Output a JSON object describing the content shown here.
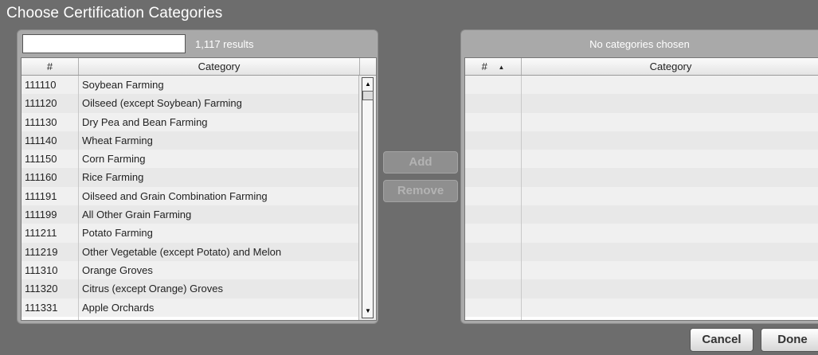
{
  "dialog": {
    "title": "Choose Certification Categories"
  },
  "left": {
    "search_value": "",
    "results": "1,117 results",
    "columns": {
      "num": "#",
      "category": "Category"
    },
    "rows": [
      {
        "num": "111110",
        "category": "Soybean Farming"
      },
      {
        "num": "111120",
        "category": "Oilseed (except Soybean) Farming"
      },
      {
        "num": "111130",
        "category": "Dry Pea and Bean Farming"
      },
      {
        "num": "111140",
        "category": "Wheat Farming"
      },
      {
        "num": "111150",
        "category": "Corn Farming"
      },
      {
        "num": "111160",
        "category": "Rice Farming"
      },
      {
        "num": "111191",
        "category": "Oilseed and Grain Combination Farming"
      },
      {
        "num": "111199",
        "category": "All Other Grain Farming"
      },
      {
        "num": "111211",
        "category": "Potato Farming"
      },
      {
        "num": "111219",
        "category": "Other Vegetable (except Potato) and Melon"
      },
      {
        "num": "111310",
        "category": "Orange Groves"
      },
      {
        "num": "111320",
        "category": "Citrus (except Orange) Groves"
      },
      {
        "num": "111331",
        "category": "Apple Orchards"
      }
    ],
    "scroll_up_glyph": "▲",
    "scroll_down_glyph": "▼"
  },
  "middle": {
    "add_label": "Add",
    "remove_label": "Remove"
  },
  "right": {
    "status": "No categories chosen",
    "columns": {
      "num": "#",
      "sort_glyph": "▲",
      "category": "Category"
    }
  },
  "footer": {
    "cancel_label": "Cancel",
    "done_label": "Done"
  }
}
